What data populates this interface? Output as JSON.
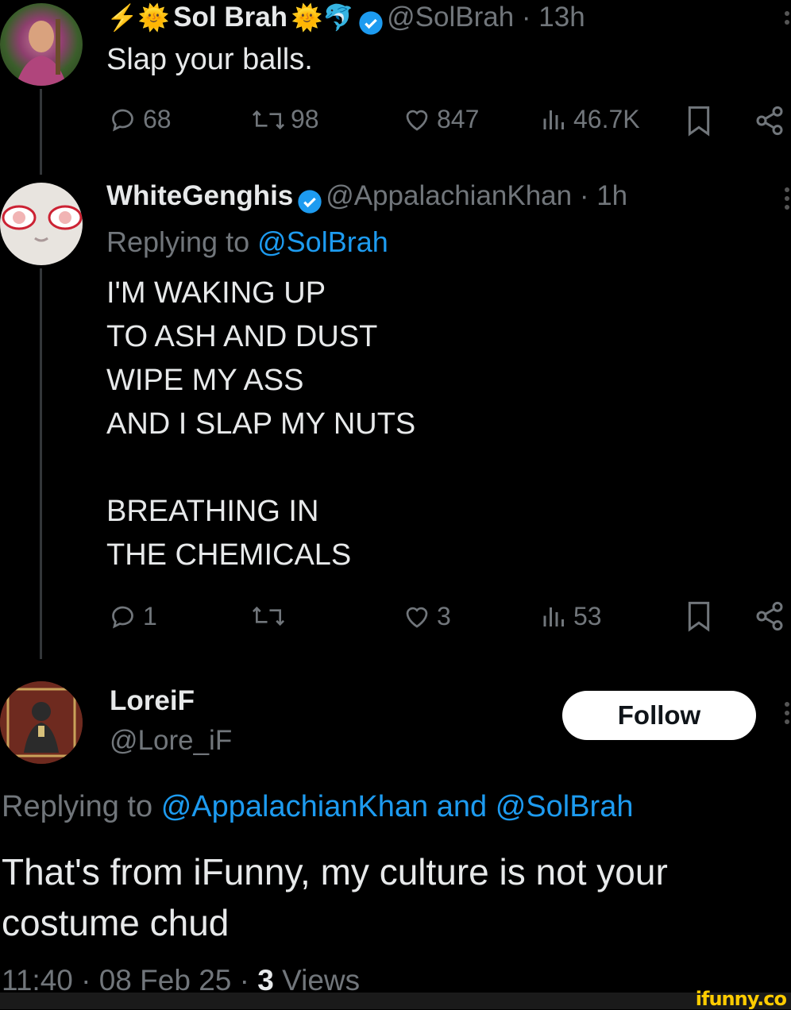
{
  "tweet1": {
    "emoji_prefix": "⚡🌞",
    "name": "Sol Brah",
    "emoji_suffix": "🌞🐬",
    "handle_time": "@SolBrah · 13h",
    "text": "Slap your balls.",
    "stats": {
      "replies": "68",
      "retweets": "98",
      "likes": "847",
      "views": "46.7K"
    }
  },
  "tweet2": {
    "name": "WhiteGenghis",
    "handle_time": "@AppalachianKhan · 1h",
    "replying_prefix": "Replying to",
    "replying_to": "@SolBrah",
    "lines": [
      "I'M WAKING UP",
      "TO ASH AND DUST",
      "WIPE MY ASS",
      "AND I SLAP MY NUTS",
      "",
      "BREATHING IN",
      "THE CHEMICALS"
    ],
    "stats": {
      "replies": "1",
      "retweets": "",
      "likes": "3",
      "views": "53"
    }
  },
  "tweet3": {
    "name": "LoreiF",
    "handle": "@Lore_iF",
    "follow_label": "Follow",
    "replying_prefix": "Replying to",
    "replying_to_1": "@AppalachianKhan",
    "replying_and": "and",
    "replying_to_2": "@SolBrah",
    "text": "That's from iFunny, my culture is not your costume chud",
    "time": "11:40 · 08 Feb 25 · ",
    "views_count": "3",
    "views_label": "Views"
  },
  "watermark": "ifunny.co",
  "colors": {
    "background": "#000000",
    "text": "#e7e9ea",
    "muted": "#71767b",
    "link": "#1d9bf0",
    "verified": "#1d9bf0"
  },
  "icons": [
    "verified-badge-icon",
    "reply-icon",
    "retweet-icon",
    "like-icon",
    "views-icon",
    "bookmark-icon",
    "share-icon",
    "more-icon"
  ]
}
